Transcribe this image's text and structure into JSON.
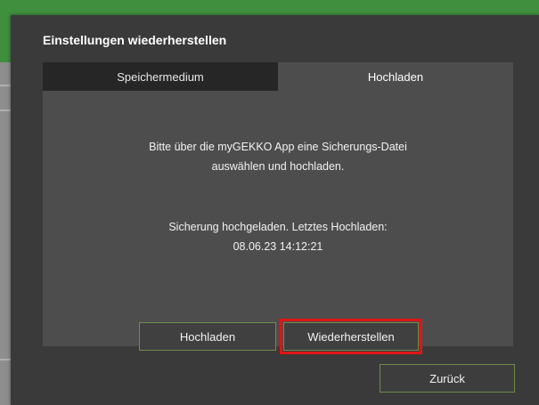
{
  "dialog": {
    "title": "Einstellungen wiederherstellen",
    "tabs": [
      {
        "label": "Speichermedium",
        "active": false
      },
      {
        "label": "Hochladen",
        "active": true
      }
    ],
    "message_line1": "Bitte über die myGEKKO App eine Sicherungs-Datei",
    "message_line2": "auswählen und hochladen.",
    "status_line1": "Sicherung hochgeladen. Letztes Hochladen:",
    "status_line2": "08.06.23 14:12:21",
    "buttons": {
      "upload": "Hochladen",
      "restore": "Wiederherstellen",
      "back": "Zurück"
    }
  },
  "colors": {
    "dialog_bg": "#3a3a3a",
    "panel_bg": "#4d4d4d",
    "tab_inactive_bg": "#262626",
    "button_border": "#6f8c4a",
    "highlight": "#e01515",
    "background_accent": "#3f8f3f"
  }
}
